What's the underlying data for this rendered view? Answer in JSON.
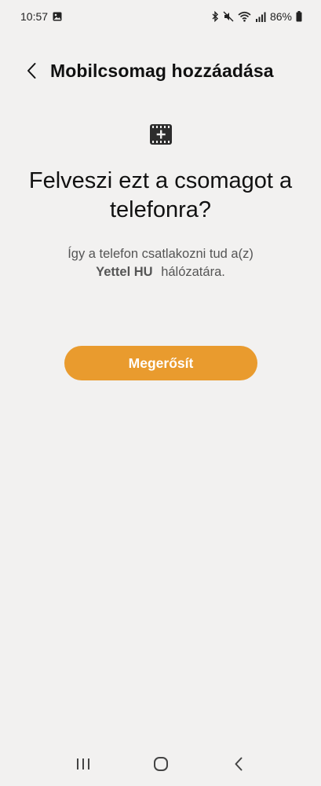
{
  "status_bar": {
    "time": "10:57",
    "battery_percent": "86%",
    "icons": [
      "gallery-icon",
      "bluetooth-icon",
      "mute-icon",
      "wifi-icon",
      "signal-icon",
      "battery-icon"
    ]
  },
  "header": {
    "back_icon": "chevron-left-icon",
    "title": "Mobilcsomag hozzáadása"
  },
  "content": {
    "icon": "esim-add-icon",
    "headline": "Felveszi ezt a csomagot a telefonra?",
    "description_prefix": "Így a telefon csatlakozni tud a(z)",
    "network_name": "Yettel HU",
    "description_suffix": "hálózatára."
  },
  "actions": {
    "confirm_label": "Megerősít",
    "confirm_color": "#e99b2e"
  },
  "navigation": {
    "recent_icon": "recent-apps-icon",
    "home_icon": "home-icon",
    "back_icon": "back-icon"
  },
  "colors": {
    "background": "#f2f1f0",
    "text_primary": "#111111",
    "text_secondary": "#555555"
  }
}
